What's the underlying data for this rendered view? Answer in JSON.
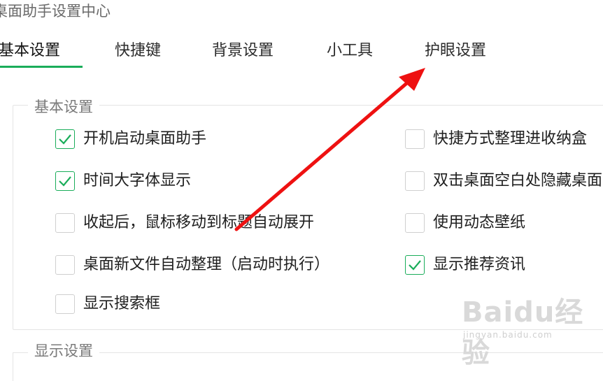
{
  "window": {
    "title": "桌面助手设置中心"
  },
  "tabs": [
    {
      "label": "基本设置",
      "active": true
    },
    {
      "label": "快捷键",
      "active": false
    },
    {
      "label": "背景设置",
      "active": false
    },
    {
      "label": "小工具",
      "active": false
    },
    {
      "label": "护眼设置",
      "active": false
    }
  ],
  "basic_group": {
    "legend": "基本设置",
    "left_options": [
      {
        "label": "开机启动桌面助手",
        "checked": true
      },
      {
        "label": "时间大字体显示",
        "checked": true
      },
      {
        "label": "收起后，鼠标移动到标题自动展开",
        "checked": false
      },
      {
        "label": "桌面新文件自动整理（启动时执行）",
        "checked": false
      },
      {
        "label": "显示搜索框",
        "checked": false
      }
    ],
    "right_options": [
      {
        "label": "快捷方式整理进收纳盒",
        "checked": false
      },
      {
        "label": "双击桌面空白处隐藏桌面",
        "checked": false
      },
      {
        "label": "使用动态壁纸",
        "checked": false
      },
      {
        "label": "显示推荐资讯",
        "checked": true
      }
    ]
  },
  "display_group": {
    "legend": "显示设置"
  },
  "watermark": {
    "brand": "Baidu经验",
    "url": "jingyan.baidu.com"
  },
  "colors": {
    "accent": "#1aad5a",
    "arrow": "#ee1111"
  }
}
